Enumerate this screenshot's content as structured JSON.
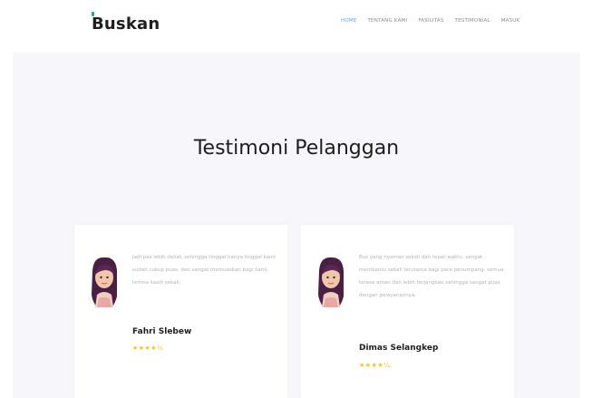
{
  "brand": {
    "name": "Buskan"
  },
  "nav": {
    "items": [
      {
        "label": "HOME",
        "active": true
      },
      {
        "label": "TENTANG KAMI",
        "active": false
      },
      {
        "label": "FASILITAS",
        "active": false
      },
      {
        "label": "TESTIMONIAL",
        "active": false
      },
      {
        "label": "MASUK",
        "active": false
      }
    ]
  },
  "testimonials": {
    "title": "Testimoni Pelanggan",
    "cards": [
      {
        "quote": "Jadi pas lebih dekat, sehingga tinggal hanya tinggal kami sudah cukup puas, dan sangat memuaskan bagi kami. terima kasih sekali.",
        "name": "Fahri Slebew",
        "rating": 4.5,
        "rating_text": "★★★★½"
      },
      {
        "quote": "Bus yang nyaman sekali dan tepat waktu. sangat membantu sekali terutama bagi para penumpang. semua terasa aman dan lebih terjangkau sehingga sangat puas dengan pelayanannya.",
        "name": "Dimas Selangkep",
        "rating": 4.5,
        "rating_text": "★★★★½"
      }
    ]
  },
  "colors": {
    "accent": "#5fa7f0",
    "logo_accent": "#20b26b",
    "section_bg": "#f7f7fb",
    "star": "#f3c21b"
  }
}
